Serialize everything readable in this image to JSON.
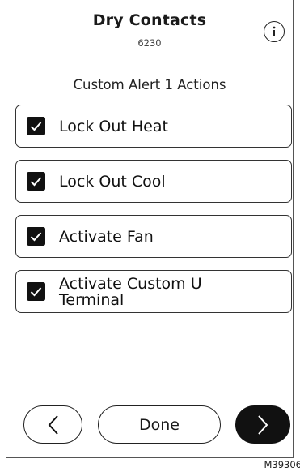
{
  "header": {
    "title": "Dry Contacts",
    "subtitle": "6230",
    "info_icon": "info-icon"
  },
  "section_title": "Custom Alert 1 Actions",
  "options": [
    {
      "label": "Lock Out Heat",
      "checked": true
    },
    {
      "label": "Lock Out Cool",
      "checked": true
    },
    {
      "label": "Activate Fan",
      "checked": true
    },
    {
      "label": "Activate Custom U Terminal",
      "checked": true
    }
  ],
  "footer": {
    "back_icon": "chevron-left-icon",
    "done_label": "Done",
    "next_icon": "chevron-right-icon"
  },
  "figure_ref": "M39306"
}
